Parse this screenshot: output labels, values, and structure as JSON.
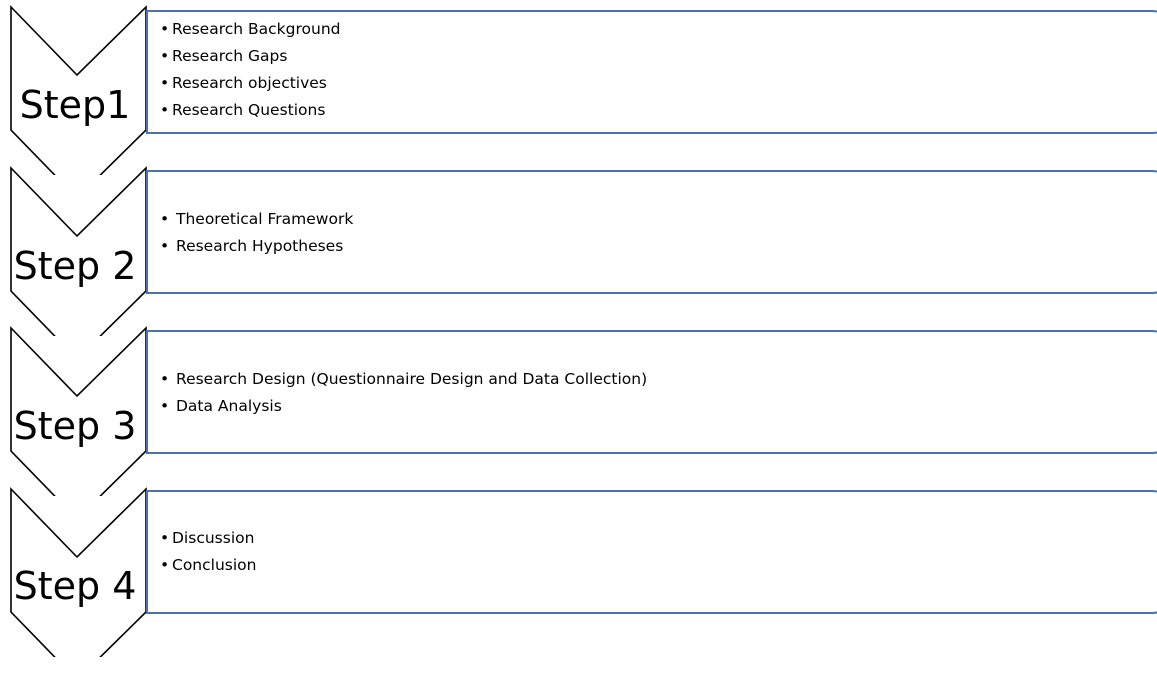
{
  "steps": [
    {
      "label": "Step1",
      "items": [
        "Research Background",
        "Research Gaps",
        "Research objectives",
        "Research Questions"
      ]
    },
    {
      "label": "Step 2",
      "items": [
        "Theoretical Framework",
        "Research Hypotheses"
      ]
    },
    {
      "label": "Step 3",
      "items": [
        "Research Design (Questionnaire Design and Data Collection)",
        "Data Analysis"
      ]
    },
    {
      "label": "Step 4",
      "items": [
        "Discussion",
        "Conclusion"
      ]
    }
  ],
  "colors": {
    "box_border": "#4a73b5",
    "chevron_stroke": "#000000",
    "text": "#000000"
  },
  "bullet": "•"
}
